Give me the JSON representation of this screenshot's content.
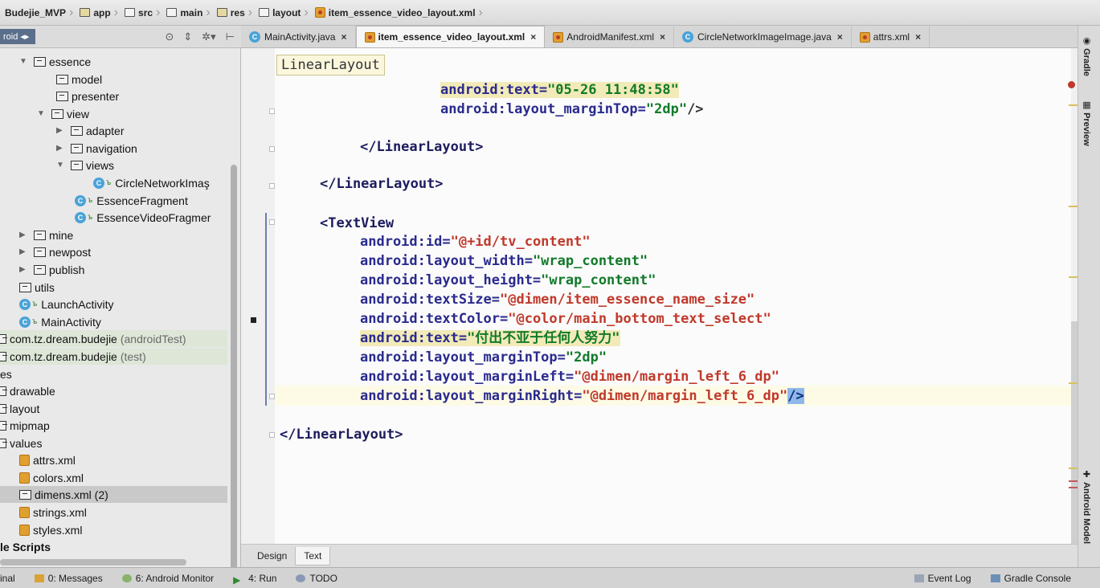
{
  "breadcrumb": [
    "Budejie_MVP",
    "app",
    "src",
    "main",
    "res",
    "layout",
    "item_essence_video_layout.xml"
  ],
  "project_panel": {
    "tag": "roid",
    "tag_icon": "arrows-icon"
  },
  "tabs": [
    {
      "label": "MainActivity.java",
      "icon": "class-icon",
      "active": false
    },
    {
      "label": "item_essence_video_layout.xml",
      "icon": "xml-icon",
      "active": true
    },
    {
      "label": "AndroidManifest.xml",
      "icon": "xml-icon",
      "active": false
    },
    {
      "label": "CircleNetworkImageImage.java",
      "icon": "class-icon",
      "active": false
    },
    {
      "label": "attrs.xml",
      "icon": "xml-icon",
      "active": false
    }
  ],
  "tree": [
    {
      "label": "essence",
      "kind": "package",
      "arrow": "▼"
    },
    {
      "label": "model",
      "kind": "package"
    },
    {
      "label": "presenter",
      "kind": "package"
    },
    {
      "label": "view",
      "kind": "package",
      "arrow": "▼"
    },
    {
      "label": "adapter",
      "kind": "package",
      "arrow": "▶"
    },
    {
      "label": "navigation",
      "kind": "package",
      "arrow": "▶"
    },
    {
      "label": "views",
      "kind": "package",
      "arrow": "▼"
    },
    {
      "label": "CircleNetworkImaş",
      "kind": "class"
    },
    {
      "label": "EssenceFragment",
      "kind": "class"
    },
    {
      "label": "EssenceVideoFragmer",
      "kind": "class"
    },
    {
      "label": "mine",
      "kind": "package",
      "arrow": "▶"
    },
    {
      "label": "newpost",
      "kind": "package",
      "arrow": "▶"
    },
    {
      "label": "publish",
      "kind": "package",
      "arrow": "▶"
    },
    {
      "label": "utils",
      "kind": "package"
    },
    {
      "label": "LaunchActivity",
      "kind": "class"
    },
    {
      "label": "MainActivity",
      "kind": "class"
    },
    {
      "label": "com.tz.dream.budejie",
      "suffix": "(androidTest)",
      "kind": "package"
    },
    {
      "label": "com.tz.dream.budejie",
      "suffix": "(test)",
      "kind": "package"
    },
    {
      "label": "es",
      "kind": "text"
    },
    {
      "label": "drawable",
      "kind": "package"
    },
    {
      "label": "layout",
      "kind": "package"
    },
    {
      "label": "mipmap",
      "kind": "package"
    },
    {
      "label": "values",
      "kind": "package"
    },
    {
      "label": "attrs.xml",
      "kind": "xml"
    },
    {
      "label": "colors.xml",
      "kind": "xml"
    },
    {
      "label": "dimens.xml (2)",
      "kind": "package"
    },
    {
      "label": "strings.xml",
      "kind": "xml"
    },
    {
      "label": "styles.xml",
      "kind": "xml"
    },
    {
      "label": "le Scripts",
      "kind": "text"
    }
  ],
  "editor": {
    "crumb_tip": "LinearLayout",
    "lines": [
      {
        "t": "android:text=\"05-26 11:48:58\""
      },
      {
        "t": "android:layout_marginTop=\"2dp\"/>"
      },
      {
        "t": "</LinearLayout>"
      },
      {
        "t": "</LinearLayout>"
      },
      {
        "t": "<TextView"
      },
      {
        "t": "android:id=\"@+id/tv_content\""
      },
      {
        "t": "android:layout_width=\"wrap_content\""
      },
      {
        "t": "android:layout_height=\"wrap_content\""
      },
      {
        "t": "android:textSize=\"@dimen/item_essence_name_size\""
      },
      {
        "t": "android:textColor=\"@color/main_bottom_text_select\""
      },
      {
        "t": "android:text=\"付出不亚于任何人努力\""
      },
      {
        "t": "android:layout_marginTop=\"2dp\""
      },
      {
        "t": "android:layout_marginLeft=\"@dimen/margin_left_6_dp\""
      },
      {
        "t": "android:layout_marginRight=\"@dimen/margin_left_6_dp\"/>"
      },
      {
        "t": "</LinearLayout>"
      }
    ]
  },
  "bottom_tabs": [
    "Design",
    "Text"
  ],
  "right_stripe": [
    "Gradle",
    "Preview",
    "Android Model"
  ],
  "status": {
    "terminal": "inal",
    "messages": "0: Messages",
    "monitor": "6: Android Monitor",
    "run": "4: Run",
    "todo": "TODO",
    "event_log": "Event Log",
    "gradle_console": "Gradle Console"
  },
  "colors": {
    "attr": "#2a2a8e",
    "value": "#117a2a",
    "value_ref": "#c0392b",
    "selection": "#8fb8ea"
  }
}
